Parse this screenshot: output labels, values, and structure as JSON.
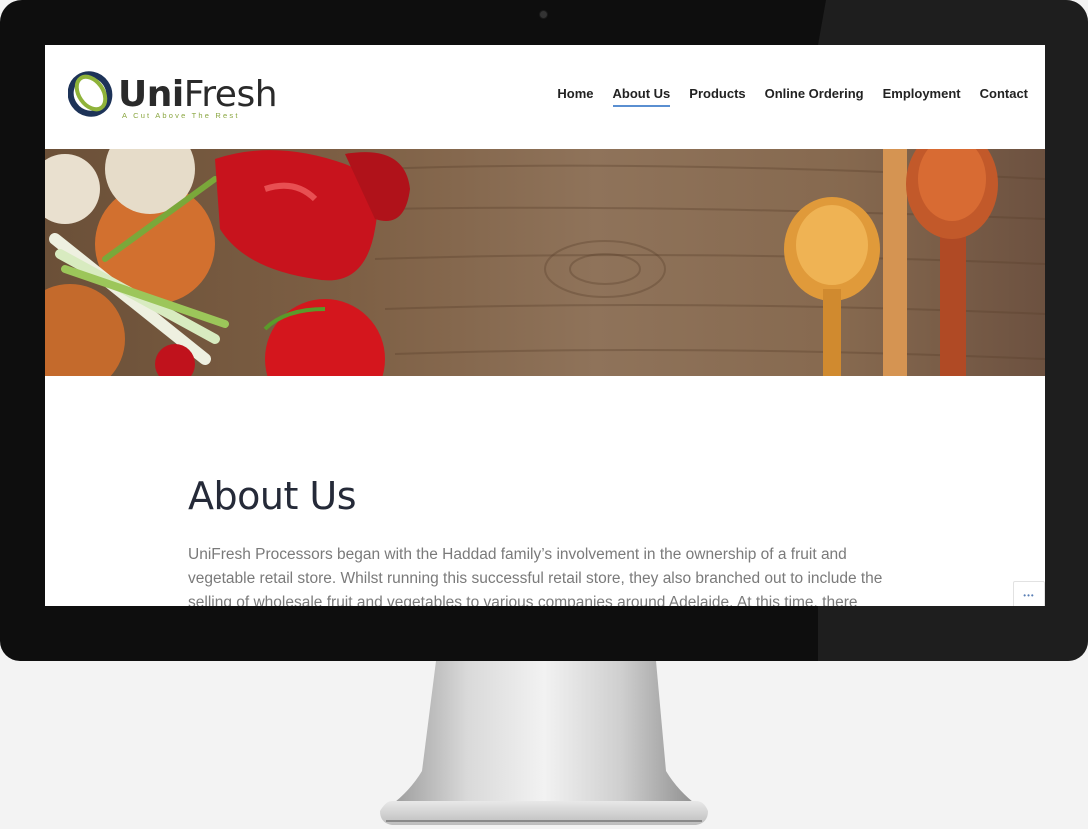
{
  "site": {
    "logo_brand_uni": "Uni",
    "logo_brand_fresh": "Fresh",
    "logo_tagline": "A Cut Above The Rest"
  },
  "nav": {
    "items": [
      {
        "label": "Home",
        "active": false
      },
      {
        "label": "About Us",
        "active": true
      },
      {
        "label": "Products",
        "active": false
      },
      {
        "label": "Online Ordering",
        "active": false
      },
      {
        "label": "Employment",
        "active": false
      },
      {
        "label": "Contact",
        "active": false
      }
    ]
  },
  "page": {
    "title": "About Us",
    "body": "UniFresh Processors began with the Haddad family’s involvement in the ownership of a fruit and vegetable retail store. Whilst running this successful retail store, they also branched out to include the selling of wholesale fruit and vegetables to various companies around Adelaide. At this time, there"
  },
  "widgets": {
    "more_button_icon": "ellipsis-icon",
    "more_button_glyph": "•••"
  },
  "colors": {
    "nav_active_underline": "#5a8fd1",
    "logo_green": "#8aa640",
    "logo_navy": "#1d3358",
    "title_color": "#252a38"
  }
}
